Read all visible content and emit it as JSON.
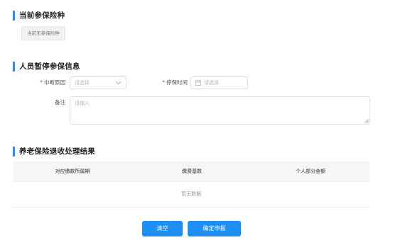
{
  "current_insurance": {
    "title": "当前参保险种",
    "none_tag": "当前无参保险种"
  },
  "suspend_form": {
    "title": "人员暂停参保信息",
    "reason": {
      "required_mark": "*",
      "label": "中断原因",
      "placeholder": "请选择"
    },
    "stop_date": {
      "required_mark": "*",
      "label": "停保时间",
      "placeholder": "请选择"
    },
    "remark": {
      "label": "备注",
      "placeholder": "请输入"
    }
  },
  "refund_result": {
    "title": "养老保险退收处理结果",
    "columns": [
      "对应缴款所属期",
      "缴费基数",
      "个人部分金额"
    ],
    "empty_text": "暂无数据"
  },
  "actions": {
    "clear_label": "清空",
    "submit_label": "确定申报"
  },
  "colors": {
    "accent": "#2d8cf0",
    "button": "#1e8ff5",
    "required": "#e0463b"
  },
  "icons": {
    "select_arrow": "chevron-down-icon",
    "date_picker": "calendar-icon",
    "textarea_resize": "resize-handle-icon"
  }
}
